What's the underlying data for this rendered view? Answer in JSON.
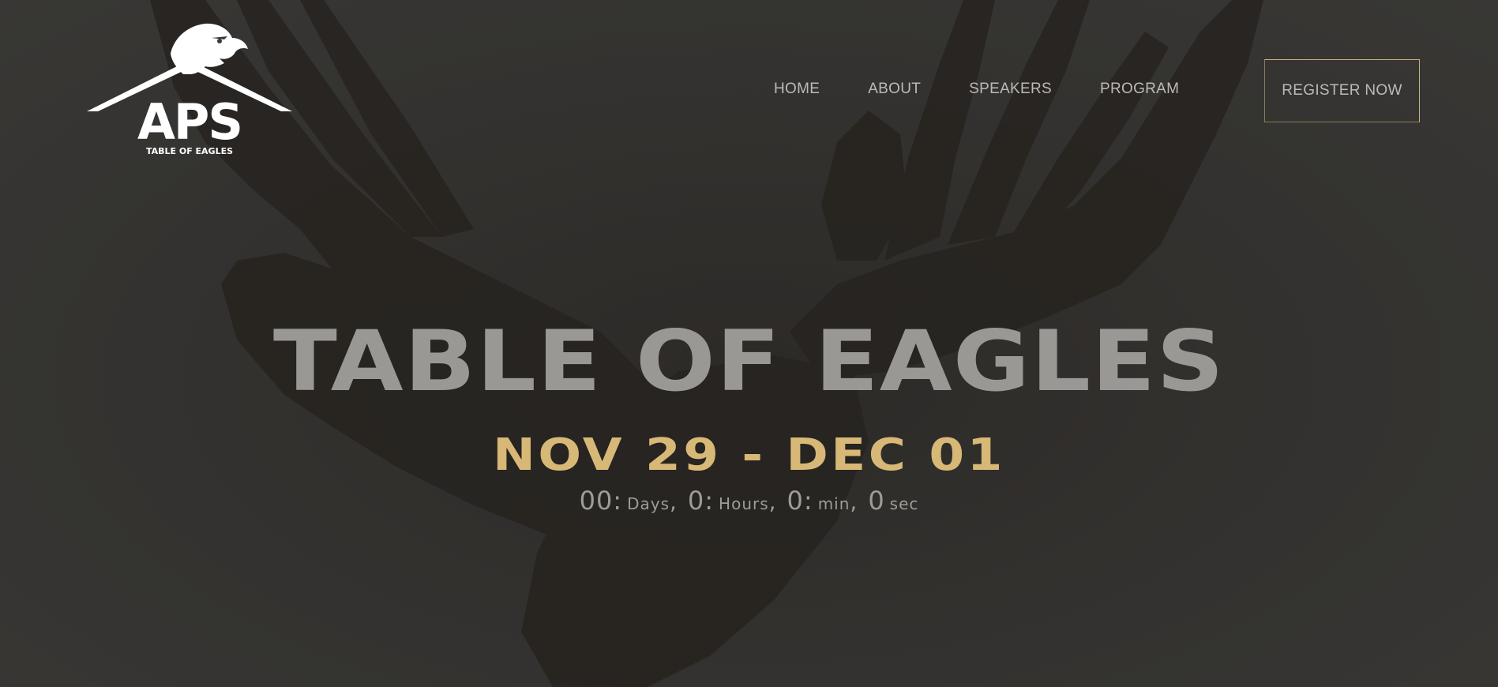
{
  "brand": {
    "logo_main": "APS",
    "logo_sub": "TABLE OF EAGLES"
  },
  "nav": {
    "items": [
      {
        "label": "HOME"
      },
      {
        "label": "ABOUT"
      },
      {
        "label": "SPEAKERS"
      },
      {
        "label": "PROGRAM"
      }
    ],
    "register_label": "REGISTER NOW"
  },
  "hero": {
    "title": "TABLE OF EAGLES",
    "dates": "NOV 29 - DEC 01",
    "countdown": {
      "days_value": "00:",
      "days_label": "Days",
      "hours_value": "0:",
      "hours_label": "Hours",
      "min_value": "0:",
      "min_label": "min",
      "sec_value": "0",
      "sec_label": "sec"
    }
  },
  "colors": {
    "accent_gold": "#d7b877",
    "title_gray": "#9a9894",
    "nav_text": "#bdbab5",
    "background": "#3b3a38"
  }
}
